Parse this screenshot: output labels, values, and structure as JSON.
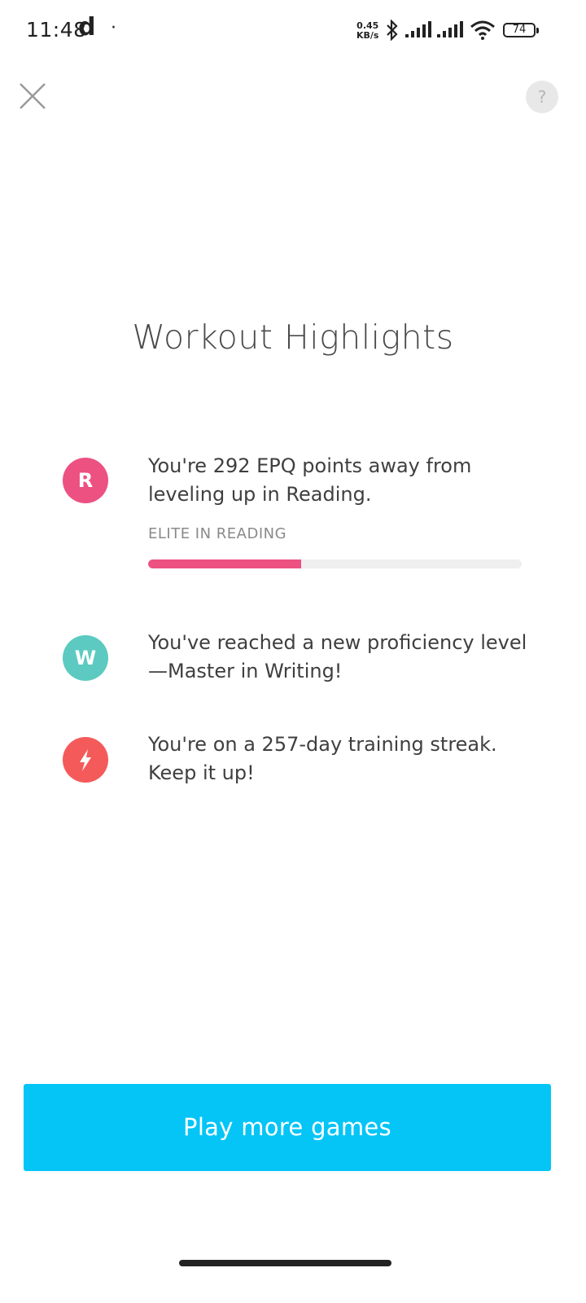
{
  "status_bar": {
    "time": "11:48",
    "app_letter": "d",
    "dot": "·",
    "net_speed_value": "0.45",
    "net_speed_unit": "KB/s",
    "battery": "74",
    "icons": [
      "bluetooth-icon",
      "signal-icon",
      "signal-icon",
      "wifi-icon",
      "battery-icon"
    ]
  },
  "header": {
    "close_icon": "close-icon",
    "help_label": "?"
  },
  "title": "Workout Highlights",
  "highlights": [
    {
      "badge_letter": "R",
      "badge_color": "#ec5182",
      "text": "You're 292 EPQ points away from leveling up in Reading.",
      "sub_label": "ELITE IN READING",
      "progress": 0.41
    },
    {
      "badge_letter": "W",
      "badge_color": "#5ccac0",
      "text": "You've reached a new proficiency level —Master in Writing!"
    },
    {
      "badge_icon": "lightning-bolt-icon",
      "badge_color": "#f55a5a",
      "text": "You're on a 257-day training streak. Keep it up!"
    }
  ],
  "cta": {
    "label": "Play more games",
    "color": "#05c5f7"
  }
}
